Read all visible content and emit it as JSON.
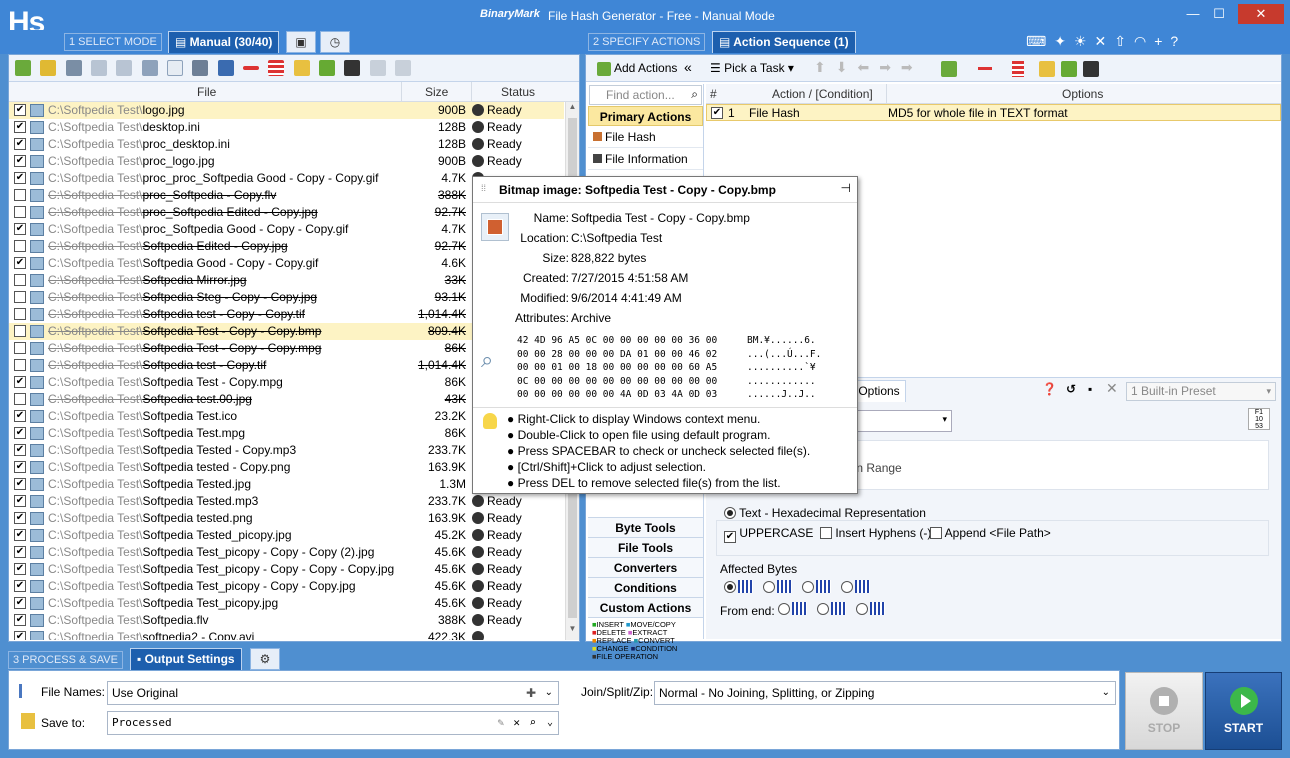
{
  "window": {
    "title": "File Hash Generator - Free - Manual Mode",
    "brand": "BinaryMark",
    "logo": "Hs",
    "min": "—",
    "max": "☐",
    "close": "✕"
  },
  "mode": {
    "step1": "1 SELECT MODE",
    "manual_tab": "Manual (30/40)",
    "step2": "2 SPECIFY ACTIONS",
    "seq_tab": "Action Sequence (1)",
    "step3": "3 PROCESS & SAVE",
    "output_tab": "Output Settings"
  },
  "filelist": {
    "headers": {
      "file": "File",
      "size": "Size",
      "status": "Status"
    },
    "rows": [
      {
        "checked": true,
        "dir": "C:\\Softpedia Test\\",
        "name": "logo.jpg",
        "size": "900B",
        "status": "Ready",
        "strike": false,
        "sel": true
      },
      {
        "checked": true,
        "dir": "C:\\Softpedia Test\\",
        "name": "desktop.ini",
        "size": "128B",
        "status": "Ready",
        "strike": false
      },
      {
        "checked": true,
        "dir": "C:\\Softpedia Test\\",
        "name": "proc_desktop.ini",
        "size": "128B",
        "status": "Ready",
        "strike": false
      },
      {
        "checked": true,
        "dir": "C:\\Softpedia Test\\",
        "name": "proc_logo.jpg",
        "size": "900B",
        "status": "Ready",
        "strike": false
      },
      {
        "checked": true,
        "dir": "C:\\Softpedia Test\\",
        "name": "proc_proc_Softpedia Good - Copy - Copy.gif",
        "size": "4.7K",
        "status": "",
        "strike": false
      },
      {
        "checked": false,
        "dir": "C:\\Softpedia Test\\",
        "name": "proc_Softpedia - Copy.flv",
        "size": "388K",
        "status": "",
        "strike": true
      },
      {
        "checked": false,
        "dir": "C:\\Softpedia Test\\",
        "name": "proc_Softpedia Edited - Copy.jpg",
        "size": "92.7K",
        "status": "",
        "strike": true
      },
      {
        "checked": true,
        "dir": "C:\\Softpedia Test\\",
        "name": "proc_Softpedia Good - Copy - Copy.gif",
        "size": "4.7K",
        "status": "",
        "strike": false
      },
      {
        "checked": false,
        "dir": "C:\\Softpedia Test\\",
        "name": "Softpedia Edited - Copy.jpg",
        "size": "92.7K",
        "status": "",
        "strike": true
      },
      {
        "checked": true,
        "dir": "C:\\Softpedia Test\\",
        "name": "Softpedia Good - Copy - Copy.gif",
        "size": "4.6K",
        "status": "",
        "strike": false
      },
      {
        "checked": false,
        "dir": "C:\\Softpedia Test\\",
        "name": "Softpedia Mirror.jpg",
        "size": "33K",
        "status": "",
        "strike": true
      },
      {
        "checked": false,
        "dir": "C:\\Softpedia Test\\",
        "name": "Softpedia Steg - Copy - Copy.jpg",
        "size": "93.1K",
        "status": "",
        "strike": true
      },
      {
        "checked": false,
        "dir": "C:\\Softpedia Test\\",
        "name": "Softpedia test - Copy - Copy.tif",
        "size": "1,014.4K",
        "status": "",
        "strike": true
      },
      {
        "checked": false,
        "dir": "C:\\Softpedia Test\\",
        "name": "Softpedia Test - Copy - Copy.bmp",
        "size": "809.4K",
        "status": "",
        "strike": true,
        "sel": true
      },
      {
        "checked": false,
        "dir": "C:\\Softpedia Test\\",
        "name": "Softpedia Test - Copy - Copy.mpg",
        "size": "86K",
        "status": "",
        "strike": true
      },
      {
        "checked": false,
        "dir": "C:\\Softpedia Test\\",
        "name": "Softpedia test - Copy.tif",
        "size": "1,014.4K",
        "status": "",
        "strike": true
      },
      {
        "checked": true,
        "dir": "C:\\Softpedia Test\\",
        "name": "Softpedia Test - Copy.mpg",
        "size": "86K",
        "status": "",
        "strike": false
      },
      {
        "checked": false,
        "dir": "C:\\Softpedia Test\\",
        "name": "Softpedia test.00.jpg",
        "size": "43K",
        "status": "",
        "strike": true
      },
      {
        "checked": true,
        "dir": "C:\\Softpedia Test\\",
        "name": "Softpedia Test.ico",
        "size": "23.2K",
        "status": "",
        "strike": false
      },
      {
        "checked": true,
        "dir": "C:\\Softpedia Test\\",
        "name": "Softpedia Test.mpg",
        "size": "86K",
        "status": "",
        "strike": false
      },
      {
        "checked": true,
        "dir": "C:\\Softpedia Test\\",
        "name": "Softpedia Tested - Copy.mp3",
        "size": "233.7K",
        "status": "",
        "strike": false
      },
      {
        "checked": true,
        "dir": "C:\\Softpedia Test\\",
        "name": "Softpedia tested - Copy.png",
        "size": "163.9K",
        "status": "",
        "strike": false
      },
      {
        "checked": true,
        "dir": "C:\\Softpedia Test\\",
        "name": "Softpedia Tested.jpg",
        "size": "1.3M",
        "status": "",
        "strike": false
      },
      {
        "checked": true,
        "dir": "C:\\Softpedia Test\\",
        "name": "Softpedia Tested.mp3",
        "size": "233.7K",
        "status": "Ready",
        "strike": false
      },
      {
        "checked": true,
        "dir": "C:\\Softpedia Test\\",
        "name": "Softpedia tested.png",
        "size": "163.9K",
        "status": "Ready",
        "strike": false
      },
      {
        "checked": true,
        "dir": "C:\\Softpedia Test\\",
        "name": "Softpedia Tested_picopy.jpg",
        "size": "45.2K",
        "status": "Ready",
        "strike": false
      },
      {
        "checked": true,
        "dir": "C:\\Softpedia Test\\",
        "name": "Softpedia Test_picopy - Copy - Copy (2).jpg",
        "size": "45.6K",
        "status": "Ready",
        "strike": false
      },
      {
        "checked": true,
        "dir": "C:\\Softpedia Test\\",
        "name": "Softpedia Test_picopy - Copy - Copy - Copy.jpg",
        "size": "45.6K",
        "status": "Ready",
        "strike": false
      },
      {
        "checked": true,
        "dir": "C:\\Softpedia Test\\",
        "name": "Softpedia Test_picopy - Copy - Copy.jpg",
        "size": "45.6K",
        "status": "Ready",
        "strike": false
      },
      {
        "checked": true,
        "dir": "C:\\Softpedia Test\\",
        "name": "Softpedia Test_picopy.jpg",
        "size": "45.6K",
        "status": "Ready",
        "strike": false
      },
      {
        "checked": true,
        "dir": "C:\\Softpedia Test\\",
        "name": "Softpedia.flv",
        "size": "388K",
        "status": "Ready",
        "strike": false
      },
      {
        "checked": true,
        "dir": "C:\\Softpedia Test\\",
        "name": "softpedia2 - Copy.avi",
        "size": "422.3K",
        "status": "",
        "strike": false
      }
    ]
  },
  "actions": {
    "add_actions": "Add Actions",
    "pick_task": "Pick a Task",
    "find_placeholder": "Find action...",
    "primary": "Primary Actions",
    "items": [
      "File Hash",
      "File Information"
    ],
    "more": [
      "Byte Tools",
      "File Tools",
      "Converters",
      "Conditions",
      "Custom Actions"
    ],
    "legend": [
      "INSERT",
      "MOVE/COPY",
      "DELETE",
      "EXTRACT",
      "REPLACE",
      "CONVERT",
      "CHANGE",
      "CONDITION",
      "FILE OPERATION"
    ],
    "seq_headers": {
      "num": "#",
      "action": "Action / [Condition]",
      "options": "Options"
    },
    "seq_row": {
      "num": "1",
      "action": "File Hash",
      "options": "MD5 for whole file in TEXT format"
    },
    "options_tab": "Options",
    "preset": "1 Built-in Preset",
    "range_text": "hin Range",
    "text_hex": "Text - Hexadecimal Representation",
    "uppercase": "UPPERCASE",
    "hyphens": "Insert Hyphens (-)",
    "append": "Append <File Path>",
    "affected": "Affected Bytes",
    "from_end": "From end:"
  },
  "tooltip": {
    "title": "Bitmap image: Softpedia Test - Copy - Copy.bmp",
    "labels": [
      "Name:",
      "Location:",
      "Size:",
      "Created:",
      "Modified:",
      "Attributes:"
    ],
    "values": [
      "Softpedia Test - Copy - Copy.bmp",
      "C:\\Softpedia Test",
      "828,822 bytes",
      "7/27/2015 4:51:58 AM",
      "9/6/2014 4:41:49 AM",
      "Archive"
    ],
    "hex": "42 4D 96 A5 0C 00 00 00 00 00 36 00\n00 00 28 00 00 00 DA 01 00 00 46 02\n00 00 01 00 18 00 00 00 00 00 60 A5\n0C 00 00 00 00 00 00 00 00 00 00 00\n00 00 00 00 00 00 4A 0D 03 4A 0D 03",
    "ascii": "BM.¥......6.\n...(...Ú...F.\n..........`¥\n............\n......J..J..",
    "hints": [
      "Right-Click to display Windows context menu.",
      "Double-Click to open file using default program.",
      "Press SPACEBAR to check or uncheck selected file(s).",
      "[Ctrl/Shift]+Click to adjust selection.",
      "Press DEL to remove selected file(s) from the list."
    ]
  },
  "output": {
    "file_names_label": "File Names:",
    "file_names_value": "Use Original",
    "save_to_label": "Save to:",
    "save_to_value": "Processed",
    "join_label": "Join/Split/Zip:",
    "join_value": "Normal - No Joining, Splitting, or Zipping",
    "stop": "STOP",
    "start": "START"
  }
}
